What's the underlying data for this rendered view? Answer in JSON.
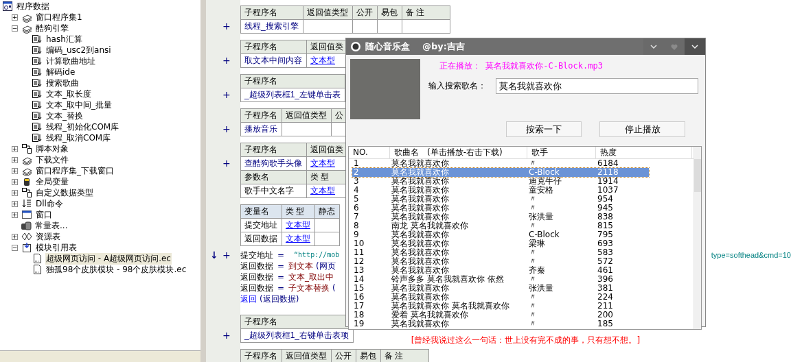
{
  "tree": {
    "label": "程序数据",
    "children": [
      {
        "label": "窗口程序集1",
        "kind": "class",
        "toggle": "+",
        "selected": false
      },
      {
        "label": "酷狗引擎",
        "kind": "class",
        "toggle": "−",
        "selected": false,
        "children": [
          {
            "label": "hash汇算",
            "kind": "sub",
            "selected": false
          },
          {
            "label": "编码_usc2到ansi",
            "kind": "sub",
            "selected": false
          },
          {
            "label": "计算歌曲地址",
            "kind": "sub",
            "selected": false
          },
          {
            "label": "解码ide",
            "kind": "sub",
            "selected": false
          },
          {
            "label": "搜索歌曲",
            "kind": "sub",
            "selected": false
          },
          {
            "label": "文本_取长度",
            "kind": "sub",
            "selected": false
          },
          {
            "label": "文本_取中间_批量",
            "kind": "sub",
            "selected": false
          },
          {
            "label": "文本_替换",
            "kind": "sub",
            "selected": false
          },
          {
            "label": "线程_初始化COM库",
            "kind": "sub",
            "selected": false
          },
          {
            "label": "线程_取消COM库",
            "kind": "sub",
            "selected": false
          }
        ]
      },
      {
        "label": "脚本对象",
        "kind": "struct",
        "toggle": "+",
        "selected": false
      },
      {
        "label": "下载文件",
        "kind": "class",
        "toggle": "+",
        "selected": false
      },
      {
        "label": "窗口程序集_下载窗口",
        "kind": "class",
        "toggle": "+",
        "selected": false
      },
      {
        "label": "全局变量",
        "kind": "global",
        "toggle": "+",
        "selected": false
      },
      {
        "label": "自定义数据类型",
        "kind": "struct",
        "toggle": "+",
        "selected": false
      },
      {
        "label": "Dll命令",
        "kind": "dll",
        "toggle": "+",
        "selected": false
      },
      {
        "label": "窗口",
        "kind": "window",
        "toggle": "+",
        "selected": false
      },
      {
        "label": "常量表...",
        "kind": "const",
        "selected": false
      },
      {
        "label": "资源表",
        "kind": "resource",
        "toggle": "+",
        "selected": false
      },
      {
        "label": "模块引用表",
        "kind": "ref",
        "toggle": "−",
        "selected": false,
        "children": [
          {
            "label": "超级网页访问 - A超级网页访问.ec",
            "kind": "file",
            "selected": true
          },
          {
            "label": "独孤98个皮肤模块 - 98个皮肤模块.ec",
            "kind": "file",
            "selected": false
          }
        ]
      }
    ]
  },
  "editor": [
    {
      "kind": "sub_table",
      "marker": "+",
      "rows": [
        {
          "kind": "header",
          "cells": [
            "子程序名",
            "返回值类型",
            "公开",
            "易包",
            "备 注"
          ]
        },
        {
          "kind": "sub",
          "cells": [
            "线程_搜索引擎"
          ]
        }
      ]
    },
    {
      "kind": "sub_table",
      "marker": "+",
      "rows": [
        {
          "kind": "header",
          "cells": [
            "子程序名",
            "返回值类"
          ]
        },
        {
          "kind": "sub",
          "cells": [
            "取文本中间内容",
            "文本型"
          ]
        }
      ]
    },
    {
      "kind": "sub_table",
      "marker": "+",
      "rows": [
        {
          "kind": "header",
          "cells": [
            "子程序名"
          ]
        },
        {
          "kind": "sub",
          "cells": [
            "_超级列表框1_左键单击表"
          ]
        }
      ]
    },
    {
      "kind": "sub_table",
      "marker": "+",
      "rows": [
        {
          "kind": "header",
          "cells": [
            "子程序名",
            "返回值类型",
            "公"
          ]
        },
        {
          "kind": "sub",
          "cells": [
            "播放音乐"
          ]
        }
      ]
    },
    {
      "kind": "sub_table",
      "marker": "+",
      "rows": [
        {
          "kind": "header",
          "cells": [
            "子程序名",
            "返回值类"
          ]
        },
        {
          "kind": "sub",
          "cells": [
            "查酷狗歌手头像",
            "文本型"
          ]
        },
        {
          "kind": "header",
          "cells": [
            "参数名",
            "类 型"
          ]
        },
        {
          "kind": "param",
          "cells": [
            "歌手中文名字",
            "文本型"
          ]
        }
      ]
    },
    {
      "kind": "var_table",
      "rows": [
        {
          "kind": "var_header",
          "cells": [
            "变量名",
            "类 型",
            "静态"
          ]
        },
        {
          "kind": "var",
          "cells": [
            "提交地址",
            "文本型"
          ]
        },
        {
          "kind": "var",
          "cells": [
            "返回数据",
            "文本型"
          ]
        }
      ]
    },
    {
      "kind": "code",
      "lines": [
        {
          "arrow": "↓",
          "marker": "+",
          "parts": [
            {
              "kind": "plain",
              "text": "提交地址"
            },
            {
              "kind": "op",
              "text": "="
            },
            {
              "kind": "string",
              "text": "“http://mob"
            }
          ],
          "tail": "type=softhead&cmd=10"
        },
        {
          "parts": [
            {
              "kind": "plain",
              "text": "返回数据"
            },
            {
              "kind": "op",
              "text": "="
            },
            {
              "kind": "func",
              "text": "到文本"
            },
            {
              "kind": "paren",
              "text": "(网页"
            }
          ]
        },
        {
          "parts": [
            {
              "kind": "plain",
              "text": "返回数据"
            },
            {
              "kind": "op",
              "text": "="
            },
            {
              "kind": "func",
              "text": "文本_取出中"
            }
          ]
        },
        {
          "parts": [
            {
              "kind": "plain",
              "text": "返回数据"
            },
            {
              "kind": "op",
              "text": "="
            },
            {
              "kind": "func",
              "text": "子文本替换"
            },
            {
              "kind": "paren",
              "text": "("
            }
          ]
        },
        {
          "parts": [
            {
              "kind": "keyword",
              "text": "返回"
            },
            {
              "kind": "paren",
              "text": "(返回数据)"
            }
          ]
        }
      ]
    },
    {
      "kind": "sub_table",
      "marker": "+",
      "rows": [
        {
          "kind": "header",
          "cells": [
            "子程序名"
          ]
        },
        {
          "kind": "sub",
          "cells": [
            "_超级列表框1_右键单击表项"
          ]
        }
      ]
    },
    {
      "kind": "sub_table",
      "rows": [
        {
          "kind": "header",
          "cells": [
            "子程序名",
            "返回值类型",
            "公开",
            "易包",
            "备 注"
          ]
        }
      ]
    }
  ],
  "player": {
    "title": "随心音乐盒",
    "author": "@by:吉吉",
    "now_playing": "正在播放： 莫名我就喜欢你-C-Block.mp3",
    "search_label": "输入搜索歌名：",
    "search_value": "莫名我就喜欢你",
    "buttons": [
      "按索一下",
      "停止播放"
    ],
    "columns": [
      "NO.",
      "歌曲名　(单击播放-右击下载)",
      "歌手",
      "热度"
    ],
    "songs": [
      {
        "no": "1",
        "title": "莫名我就喜欢你",
        "singer": "〃",
        "heat": "6184",
        "selected": false
      },
      {
        "no": "2",
        "title": "莫名我就喜欢你",
        "singer": "C-Block",
        "heat": "2118",
        "selected": true
      },
      {
        "no": "3",
        "title": "莫名我就喜欢你",
        "singer": "迪克牛仔",
        "heat": "1914",
        "selected": false
      },
      {
        "no": "4",
        "title": "莫名我就喜欢你",
        "singer": "童安格",
        "heat": "1037",
        "selected": false
      },
      {
        "no": "5",
        "title": "莫名我就喜欢你",
        "singer": "〃",
        "heat": "954",
        "selected": false
      },
      {
        "no": "6",
        "title": "莫名我就喜欢你",
        "singer": "〃",
        "heat": "945",
        "selected": false
      },
      {
        "no": "7",
        "title": "莫名我就喜欢你",
        "singer": "张洪量",
        "heat": "838",
        "selected": false
      },
      {
        "no": "8",
        "title": "南龙 莫名我就喜欢你",
        "singer": "〃",
        "heat": "815",
        "selected": false
      },
      {
        "no": "9",
        "title": "莫名我就喜欢你",
        "singer": "C-Block",
        "heat": "795",
        "selected": false
      },
      {
        "no": "10",
        "title": "莫名我就喜欢你",
        "singer": "梁琳",
        "heat": "693",
        "selected": false
      },
      {
        "no": "11",
        "title": "莫名我就喜欢你",
        "singer": "〃",
        "heat": "583",
        "selected": false
      },
      {
        "no": "12",
        "title": "莫名我就喜欢你",
        "singer": "〃",
        "heat": "572",
        "selected": false
      },
      {
        "no": "13",
        "title": "莫名我就喜欢你",
        "singer": "齐秦",
        "heat": "461",
        "selected": false
      },
      {
        "no": "14",
        "title": "铃声多多 莫名我就喜欢你 依然",
        "singer": "〃",
        "heat": "396",
        "selected": false
      },
      {
        "no": "15",
        "title": "莫名我就喜欢你",
        "singer": "张洪量",
        "heat": "381",
        "selected": false
      },
      {
        "no": "16",
        "title": "莫名我就喜欢你",
        "singer": "〃",
        "heat": "224",
        "selected": false
      },
      {
        "no": "17",
        "title": "莫名我就喜欢你 莫名我就喜欢你",
        "singer": "〃",
        "heat": "211",
        "selected": false
      },
      {
        "no": "18",
        "title": "爱着 莫名我就喜欢你",
        "singer": "〃",
        "heat": "200",
        "selected": false
      },
      {
        "no": "19",
        "title": "莫名我就喜欢你",
        "singer": "〃",
        "heat": "185",
        "selected": false
      }
    ],
    "footer": "[曾经我说过这么一句话：世上没有完不成的事，只有想不想。]"
  }
}
